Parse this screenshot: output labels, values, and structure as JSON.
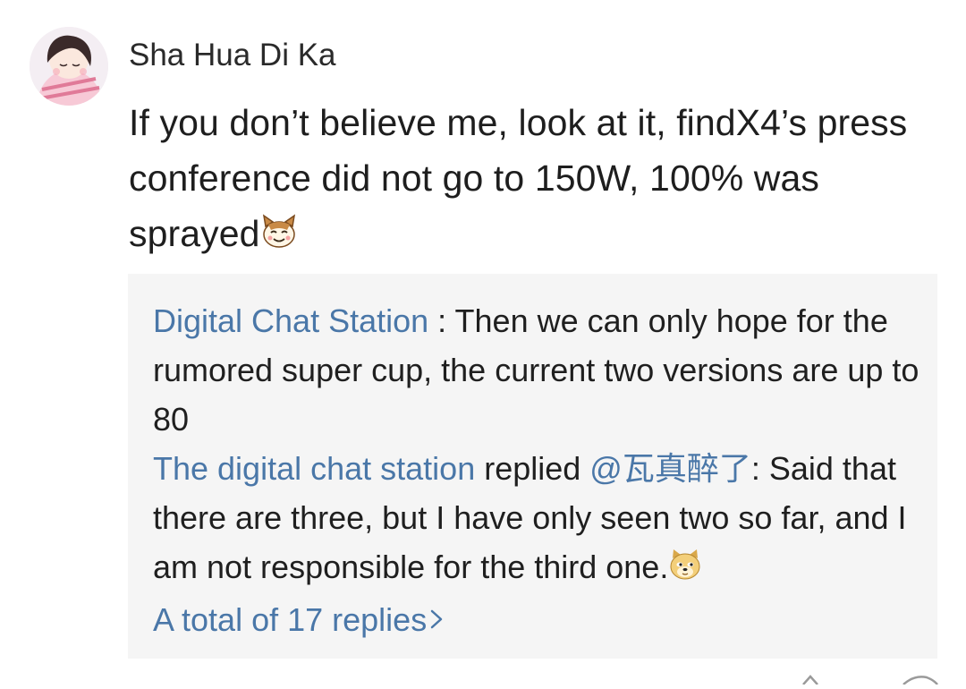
{
  "comment": {
    "username": "Sha Hua Di Ka",
    "text": "If you don’t believe me, look at it, findX4’s press conference did not go to 150W, 100% was sprayed",
    "emoji": "cat-face-icon"
  },
  "replies": {
    "first": {
      "author": "Digital Chat Station",
      "separator": " : ",
      "text": "Then we can only hope for the rumored super cup, the current two versions are up to 80"
    },
    "second": {
      "author": "The digital chat station",
      "verb": " replied ",
      "mention": "@瓦真醉了",
      "separator": ": ",
      "text": "Said that there are three, but I have only seen two so far, and I am not responsible for the third one.",
      "emoji": "doge-icon"
    },
    "more_label": "A total of 17 replies",
    "more_icon": "chevron-right-icon"
  },
  "colors": {
    "link": "#4a77a8",
    "reply_background": "#f5f5f5"
  }
}
